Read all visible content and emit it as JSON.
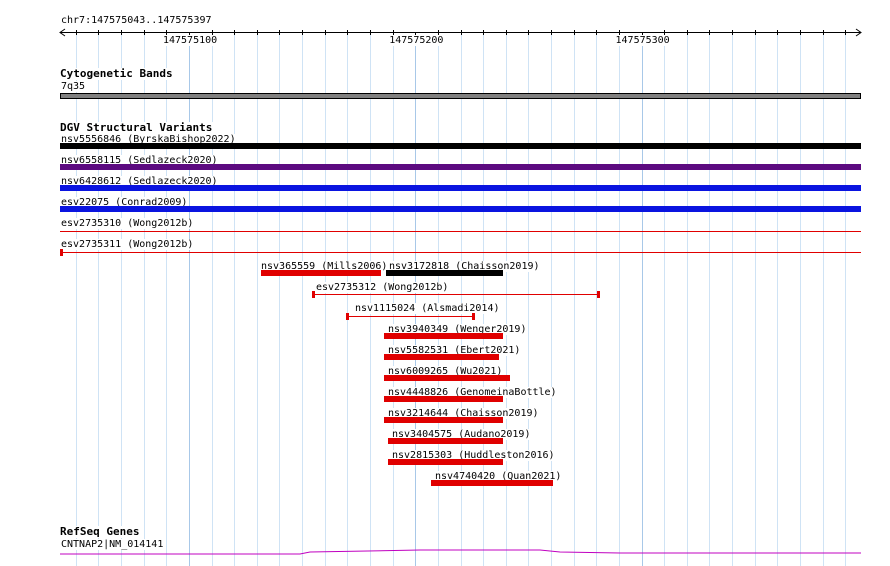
{
  "ruler": {
    "range_label": "chr7:147575043..147575397",
    "start": 147575043,
    "end": 147575397,
    "ticks": [
      "147575100",
      "147575200",
      "147575300"
    ]
  },
  "cytoband_track": {
    "title": "Cytogenetic Bands",
    "band_label": "7q35",
    "band_color": "#808080"
  },
  "dgv_track": {
    "title": "DGV Structural Variants",
    "variants": [
      {
        "label": "nsv5556846 (ByrskaBishop2022)",
        "color": "#000000",
        "style": "thick",
        "start": 147575043,
        "end": 147575397
      },
      {
        "label": "nsv6558115 (Sedlazeck2020)",
        "color": "#5c0a80",
        "style": "thick",
        "start": 147575043,
        "end": 147575397
      },
      {
        "label": "nsv6428612 (Sedlazeck2020)",
        "color": "#0a14e0",
        "style": "thick",
        "start": 147575043,
        "end": 147575397
      },
      {
        "label": "esv22075 (Conrad2009)",
        "color": "#0a14e0",
        "style": "thick",
        "start": 147575043,
        "end": 147575397
      },
      {
        "label": "esv2735310 (Wong2012b)",
        "color": "#e00000",
        "style": "thin",
        "start": 147575043,
        "end": 147575397
      },
      {
        "label": "esv2735311 (Wong2012b)",
        "color": "#e00000",
        "style": "thin",
        "start": 147575043,
        "end": 147575397
      },
      {
        "label": "nsv365559 (Mills2006)",
        "color": "#e00000",
        "style": "thick",
        "start": 147575132,
        "end": 147575185
      },
      {
        "label": "nsv3172818 (Chaisson2019)",
        "color": "#000000",
        "style": "thick",
        "start": 147575187,
        "end": 147575239
      },
      {
        "label": "esv2735312 (Wong2012b)",
        "color": "#e00000",
        "style": "thin",
        "start": 147575155,
        "end": 147575281
      },
      {
        "label": "nsv1115024 (Alsmadi2014)",
        "color": "#e00000",
        "style": "thin",
        "start": 147575170,
        "end": 147575226
      },
      {
        "label": "nsv3940349 (Wenger2019)",
        "color": "#e00000",
        "style": "thick",
        "start": 147575186,
        "end": 147575239
      },
      {
        "label": "nsv5582531 (Ebert2021)",
        "color": "#e00000",
        "style": "thick",
        "start": 147575186,
        "end": 147575237
      },
      {
        "label": "nsv6009265 (Wu2021)",
        "color": "#e00000",
        "style": "thick",
        "start": 147575186,
        "end": 147575242
      },
      {
        "label": "nsv4448826 (GenomeinaBottle)",
        "color": "#e00000",
        "style": "thick",
        "start": 147575186,
        "end": 147575239
      },
      {
        "label": "nsv3214644 (Chaisson2019)",
        "color": "#e00000",
        "style": "thick",
        "start": 147575186,
        "end": 147575239
      },
      {
        "label": "nsv3404575 (Audano2019)",
        "color": "#e00000",
        "style": "thick",
        "start": 147575188,
        "end": 147575239
      },
      {
        "label": "nsv2815303 (Huddleston2016)",
        "color": "#e00000",
        "style": "thick",
        "start": 147575188,
        "end": 147575239
      },
      {
        "label": "nsv4740420 (Quan2021)",
        "color": "#e00000",
        "style": "thick",
        "start": 147575207,
        "end": 147575261
      }
    ]
  },
  "refseq_track": {
    "title": "RefSeq Genes",
    "gene_label": "CNTNAP2|NM_014141",
    "gene_color": "#c000c0"
  }
}
